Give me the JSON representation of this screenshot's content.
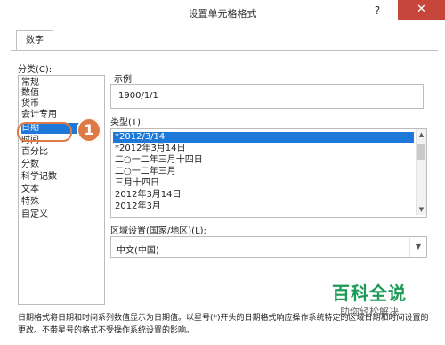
{
  "window": {
    "title": "设置单元格格式",
    "help_label": "?",
    "close_label": "✕"
  },
  "tabs": [
    {
      "label": "数字"
    }
  ],
  "category": {
    "label": "分类(C):",
    "items": [
      "常规",
      "数值",
      "货币",
      "会计专用",
      "日期",
      "时间",
      "百分比",
      "分数",
      "科学记数",
      "文本",
      "特殊",
      "自定义"
    ],
    "selected": "日期"
  },
  "sample": {
    "label": "示例",
    "value": "1900/1/1"
  },
  "type": {
    "label": "类型(T):",
    "items": [
      "*2012/3/14",
      "*2012年3月14日",
      "二○一二年三月十四日",
      "二○一二年三月",
      "三月十四日",
      "2012年3月14日",
      "2012年3月"
    ],
    "selected": "*2012/3/14"
  },
  "locale": {
    "label": "区域设置(国家/地区)(L):",
    "value": "中文(中国)"
  },
  "description": {
    "text": "日期格式将日期和时间系列数值显示为日期值。以星号(*)开头的日期格式响应操作系统特定的区域日期和时间设置的更改。不带星号的格式不受操作系统设置的影响。"
  },
  "annotation": {
    "step_number": "1",
    "color": "#e07a45"
  },
  "watermark": {
    "main": "百科全说",
    "sub": "助你轻松解决"
  },
  "colors": {
    "selection": "#1e78d7",
    "close_button": "#c7463b",
    "watermark_green": "#1c9b57"
  }
}
